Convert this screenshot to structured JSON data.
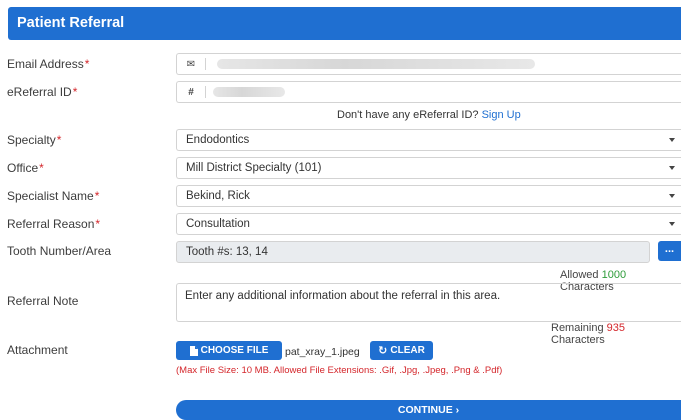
{
  "header": {
    "title": "Patient Referral"
  },
  "email": {
    "label": "Email Address",
    "required_mark": "*",
    "icon": "envelope-icon",
    "icon_glyph": "✉"
  },
  "ereferral": {
    "label": "eReferral ID",
    "required_mark": "*",
    "icon": "hash-icon",
    "icon_glyph": "#"
  },
  "signup": {
    "prompt": "Don't have any eReferral ID?",
    "link": "Sign Up"
  },
  "specialty": {
    "label": "Specialty",
    "required_mark": "*",
    "value": "Endodontics"
  },
  "office": {
    "label": "Office",
    "required_mark": "*",
    "value": "Mill District Specialty (101)"
  },
  "specialist": {
    "label": "Specialist Name",
    "required_mark": "*",
    "value": "Bekind, Rick"
  },
  "reason": {
    "label": "Referral Reason",
    "required_mark": "*",
    "value": "Consultation"
  },
  "tooth": {
    "label": "Tooth Number/Area",
    "value": "Tooth #s: 13, 14",
    "button_label": "..."
  },
  "allowed": {
    "prefix": "Allowed",
    "count": "1000",
    "suffix": "Characters"
  },
  "note": {
    "label": "Referral Note",
    "placeholder": "Enter any additional information about the referral in this area."
  },
  "remaining": {
    "prefix": "Remaining",
    "count": "935",
    "suffix": "Characters"
  },
  "attachment": {
    "label": "Attachment",
    "choose_label": "CHOOSE FILE",
    "file_name": "pat_xray_1.jpeg",
    "clear_label": "CLEAR",
    "hint": "(Max File Size: 10 MB. Allowed File Extensions: .Gif, .Jpg, .Jpeg, .Png & .Pdf)"
  },
  "continue": {
    "label": "CONTINUE ›"
  },
  "colors": {
    "accent": "#1f6fd1",
    "required": "#d4262b",
    "allowed_count": "#2e9c3a",
    "remaining_count": "#d4262b"
  }
}
